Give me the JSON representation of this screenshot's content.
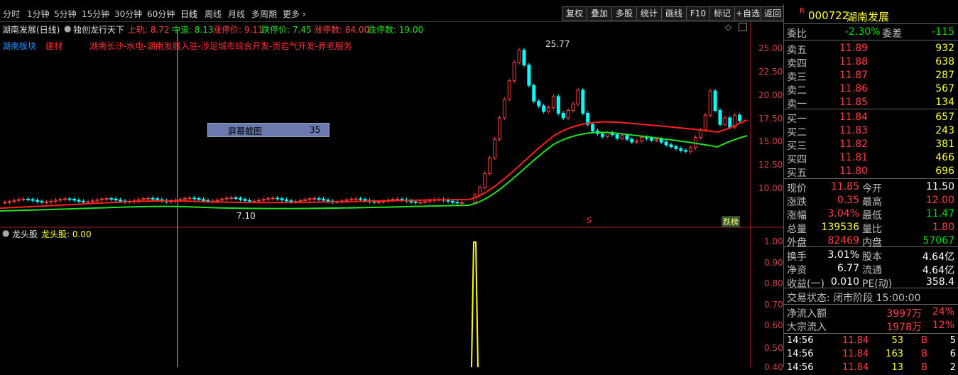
{
  "period_bar": {
    "items": [
      "分时",
      "1分钟",
      "5分钟",
      "15分钟",
      "30分钟",
      "60分钟",
      "日线",
      "周线",
      "月线",
      "多周期",
      "更多 ›"
    ],
    "active": "日线",
    "tools": [
      "复权",
      "叠加",
      "多股",
      "统计",
      "画线",
      "F10",
      "标记",
      "+自选",
      "返回"
    ]
  },
  "chart_header": {
    "stock_period": "湖南发展(日线)",
    "indicator_name": "独创龙行天下",
    "upper_label": "上轨: 8.72",
    "mid_label": "中道: 8.13",
    "limit_down_label": "涨停价: 9.11",
    "drop_price_label": "跌停价: 7.45",
    "limit_up_count": "涨停数: 84.00",
    "limit_down_count": "跌停数: 19.00"
  },
  "concepts": {
    "sector_label": "湖南板块",
    "industry": "建材",
    "tags": "湖南长沙-水电-湖南发展入驻-涉足城市综合开发-页岩气开发-养老服务"
  },
  "price_chart": {
    "y_ticks": [
      "25.00",
      "22.50",
      "20.00",
      "17.50",
      "15.00",
      "12.50",
      "10.00"
    ],
    "high_label": "25.77",
    "low_label": "7.10",
    "overlay_box_label": "屏幕截图",
    "overlay_box_value": "35",
    "marker_s": "S",
    "badge": "跌榜"
  },
  "lower_panel": {
    "title": "龙头股",
    "value_label": "龙头股: 0.00",
    "y_ticks": [
      "1.00",
      "0.90",
      "0.80",
      "0.70",
      "0.60",
      "0.50",
      "0.40"
    ]
  },
  "quote": {
    "code": "000722",
    "name": "湖南发展",
    "wb_label": "委比",
    "wb_value": "-2.30%",
    "wc_label": "委差",
    "wc_value": "-115",
    "asks": [
      {
        "label": "卖五",
        "price": "11.89",
        "vol": "932"
      },
      {
        "label": "卖四",
        "price": "11.88",
        "vol": "638"
      },
      {
        "label": "卖三",
        "price": "11.87",
        "vol": "287"
      },
      {
        "label": "卖二",
        "price": "11.86",
        "vol": "567"
      },
      {
        "label": "卖一",
        "price": "11.85",
        "vol": "134"
      }
    ],
    "bids": [
      {
        "label": "买一",
        "price": "11.84",
        "vol": "657"
      },
      {
        "label": "买二",
        "price": "11.83",
        "vol": "243"
      },
      {
        "label": "买三",
        "price": "11.82",
        "vol": "381"
      },
      {
        "label": "买四",
        "price": "11.81",
        "vol": "466"
      },
      {
        "label": "买五",
        "price": "11.80",
        "vol": "696"
      }
    ],
    "stats": [
      {
        "l1": "现价",
        "v1": "11.85",
        "c1": "red",
        "l2": "今开",
        "v2": "11.50",
        "c2": "wht"
      },
      {
        "l1": "涨跌",
        "v1": "0.35",
        "c1": "red",
        "l2": "最高",
        "v2": "12.00",
        "c2": "red"
      },
      {
        "l1": "涨幅",
        "v1": "3.04%",
        "c1": "red",
        "l2": "最低",
        "v2": "11.47",
        "c2": "grn"
      },
      {
        "l1": "总量",
        "v1": "139536",
        "c1": "yel",
        "l2": "量比",
        "v2": "1.80",
        "c2": "red"
      },
      {
        "l1": "外盘",
        "v1": "82469",
        "c1": "red",
        "l2": "内盘",
        "v2": "57067",
        "c2": "grn"
      }
    ],
    "stats2": [
      {
        "l1": "换手",
        "v1": "3.01%",
        "l2": "股本",
        "v2": "4.64亿"
      },
      {
        "l1": "净资",
        "v1": "6.77",
        "l2": "流通",
        "v2": "4.64亿"
      },
      {
        "l1": "收益(一)",
        "v1": "0.010",
        "l2": "PE(动)",
        "v2": "358.4"
      }
    ],
    "trade_status": "交易状态: 闭市阶段 15:00:00",
    "flows": [
      {
        "label": "净流入额",
        "amount": "3997万",
        "pct": "24%"
      },
      {
        "label": "大宗流入",
        "amount": "1978万",
        "pct": "12%"
      }
    ],
    "ticks": [
      {
        "time": "14:56",
        "price": "11.84",
        "vol": "53",
        "side": "B",
        "n": "5"
      },
      {
        "time": "14:56",
        "price": "11.84",
        "vol": "163",
        "side": "B",
        "n": "6"
      },
      {
        "time": "14:56",
        "price": "11.84",
        "vol": "13",
        "side": "B",
        "n": "2"
      }
    ]
  },
  "colors": {
    "up": "#ff4040",
    "down": "#00ffff",
    "upper_line": "#ff2020",
    "mid_line": "#20e020",
    "volume_line": "#ffff00"
  }
}
